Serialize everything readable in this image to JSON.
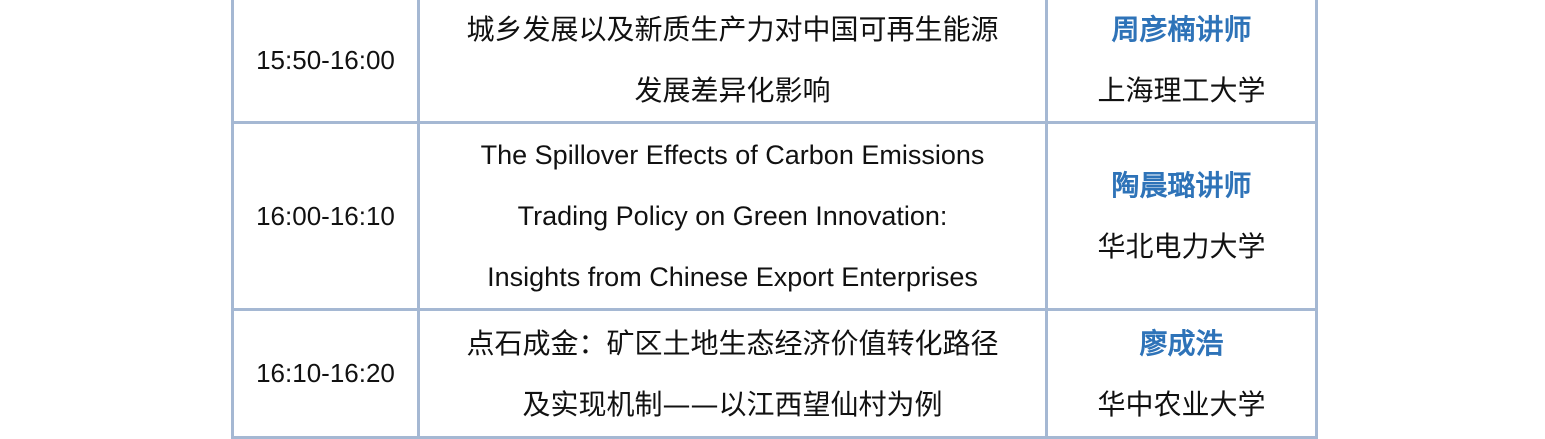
{
  "rows": [
    {
      "time": "15:50-16:00",
      "topic": [
        "城乡发展以及新质生产力对中国可再生能源",
        "发展差异化影响"
      ],
      "speaker": "周彦楠讲师",
      "affiliation": "上海理工大学"
    },
    {
      "time": "16:00-16:10",
      "topic": [
        "The Spillover Effects of Carbon Emissions",
        "Trading Policy on Green Innovation:",
        "Insights from Chinese Export Enterprises"
      ],
      "speaker": "陶晨璐讲师",
      "affiliation": "华北电力大学"
    },
    {
      "time": "16:10-16:20",
      "topic": [
        "点石成金：矿区土地生态经济价值转化路径",
        "及实现机制——以江西望仙村为例"
      ],
      "speaker": "廖成浩",
      "affiliation": "华中农业大学"
    }
  ],
  "colors": {
    "border": "#a5b8d3",
    "speaker": "#2e73b8"
  }
}
